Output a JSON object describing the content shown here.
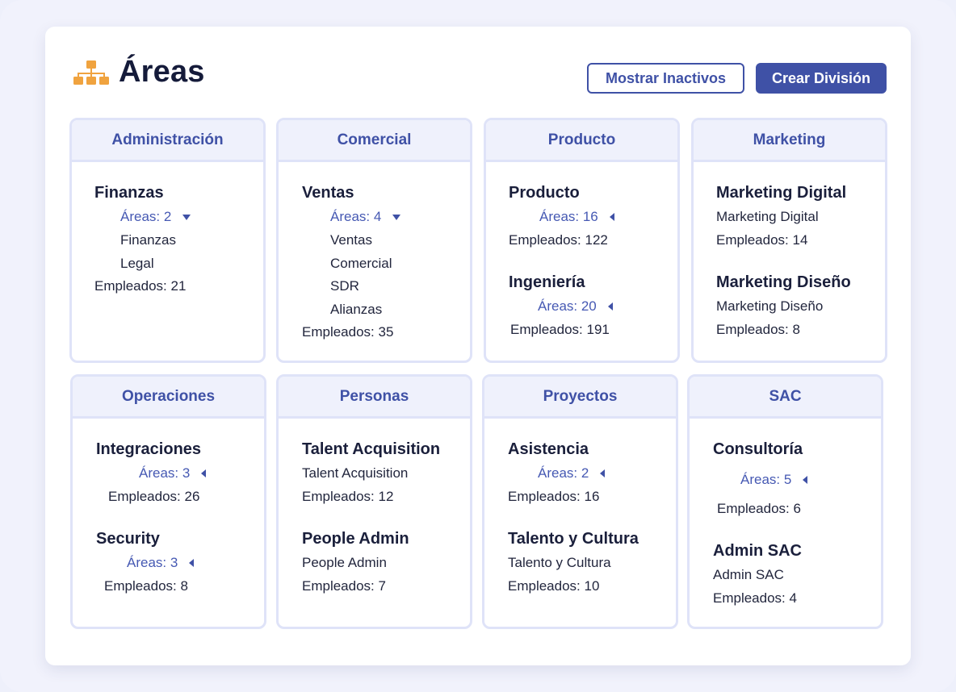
{
  "header": {
    "title": "Áreas",
    "icon": "org-chart-icon",
    "icon_color": "#f0a33f",
    "buttons": {
      "show_inactive": "Mostrar Inactivos",
      "create_division": "Crear División"
    }
  },
  "colors": {
    "accent": "#3f51a6",
    "card_border": "#dfe3f8",
    "card_header_bg": "#eff1fc"
  },
  "divisions": {
    "administracion": {
      "name": "Administración",
      "subs": [
        {
          "name": "Finanzas",
          "areas_label": "Áreas: 2",
          "areas": [
            "Finanzas",
            "Legal"
          ],
          "employees": "Empleados: 21"
        }
      ]
    },
    "comercial": {
      "name": "Comercial",
      "subs": [
        {
          "name": "Ventas",
          "areas_label": "Áreas: 4",
          "areas": [
            "Ventas",
            "Comercial",
            "SDR",
            "Alianzas"
          ],
          "employees": "Empleados: 35"
        }
      ]
    },
    "producto": {
      "name": "Producto",
      "subs": [
        {
          "name": "Producto",
          "areas_label": "Áreas: 16",
          "employees": "Empleados: 122"
        },
        {
          "name": "Ingeniería",
          "areas_label": "Áreas: 20",
          "employees": "Empleados: 191"
        }
      ]
    },
    "marketing": {
      "name": "Marketing",
      "subs": [
        {
          "name": "Marketing Digital",
          "area": "Marketing Digital",
          "employees": "Empleados: 14"
        },
        {
          "name": "Marketing Diseño",
          "area": "Marketing Diseño",
          "employees": "Empleados: 8"
        }
      ]
    },
    "operaciones": {
      "name": "Operaciones",
      "subs": [
        {
          "name": "Integraciones",
          "areas_label": "Áreas: 3",
          "employees": "Empleados: 26"
        },
        {
          "name": "Security",
          "areas_label": "Áreas: 3",
          "employees": "Empleados: 8"
        }
      ]
    },
    "personas": {
      "name": "Personas",
      "subs": [
        {
          "name": "Talent Acquisition",
          "area": "Talent Acquisition",
          "employees": "Empleados: 12"
        },
        {
          "name": "People Admin",
          "area": "People Admin",
          "employees": "Empleados: 7"
        }
      ]
    },
    "proyectos": {
      "name": "Proyectos",
      "subs": [
        {
          "name": "Asistencia",
          "areas_label": "Áreas: 2",
          "employees": "Empleados: 16"
        },
        {
          "name": "Talento y Cultura",
          "area": "Talento y Cultura",
          "employees": "Empleados: 10"
        }
      ]
    },
    "sac": {
      "name": "SAC",
      "subs": [
        {
          "name": "Consultoría",
          "areas_label": "Áreas: 5",
          "employees": "Empleados: 6"
        },
        {
          "name": "Admin SAC",
          "area": "Admin SAC",
          "employees": "Empleados: 4"
        }
      ]
    }
  }
}
